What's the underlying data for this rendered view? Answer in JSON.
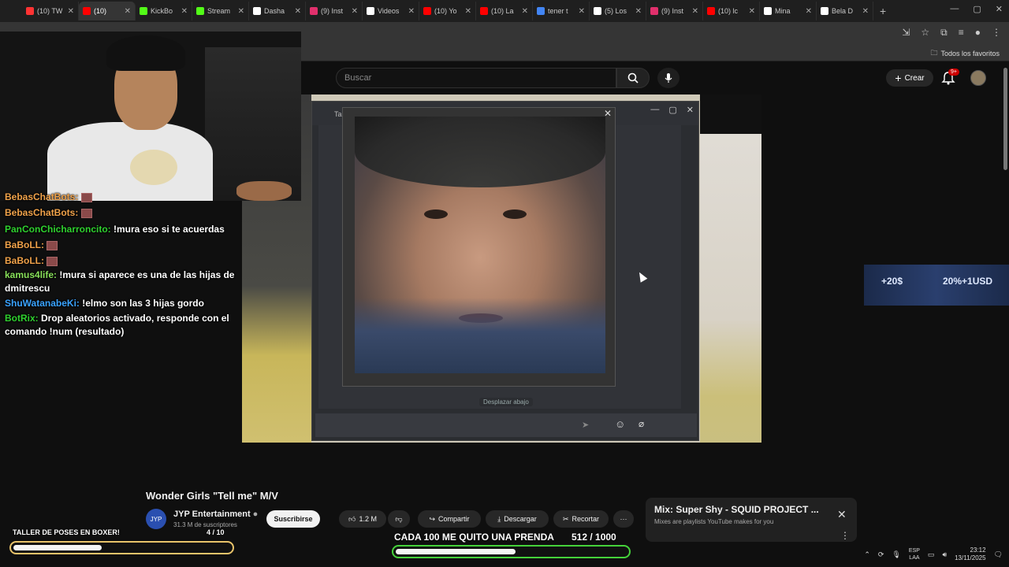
{
  "browser": {
    "tabs": [
      {
        "label": "(10) TW",
        "color": "#ff3333"
      },
      {
        "label": "(10)",
        "color": "#ff0000",
        "active": true
      },
      {
        "label": "KickBo",
        "color": "#53fc18"
      },
      {
        "label": "Stream",
        "color": "#53fc18"
      },
      {
        "label": "Dasha",
        "color": "#ffffff"
      },
      {
        "label": "(9) Inst",
        "color": "#e1306c"
      },
      {
        "label": "Videos",
        "color": "#ffffff"
      },
      {
        "label": "(10) Yo",
        "color": "#ff0000"
      },
      {
        "label": "(10) La",
        "color": "#ff0000"
      },
      {
        "label": "tener t",
        "color": "#4285f4"
      },
      {
        "label": "(5) Los",
        "color": "#ffffff"
      },
      {
        "label": "(9) Inst",
        "color": "#e1306c"
      },
      {
        "label": "(10) lc",
        "color": "#ff0000"
      },
      {
        "label": "Mina",
        "color": "#ffffff"
      },
      {
        "label": "Bela D",
        "color": "#ffffff"
      }
    ],
    "new_tab": "+",
    "all_bookmarks": "Todos los favoritos"
  },
  "youtube": {
    "search_placeholder": "Buscar",
    "create_label": "Crear",
    "notif_badge": "9+",
    "video_title": "Wonder Girls \"Tell me\" M/V",
    "channel_name": "JYP Entertainment",
    "channel_avatar_text": "JYP",
    "subscribers": "31.3 M de suscriptores",
    "subscribe_label": "Suscribirse",
    "likes": "1.2 M",
    "share_label": "Compartir",
    "download_label": "Descargar",
    "clip_label": "Recortar",
    "more_label": "···",
    "mix_title": "Mix: Super Shy - SQUID PROJECT ...",
    "mix_subtitle": "Mixes are playlists YouTube makes for you"
  },
  "chatwindow": {
    "title": "Ta",
    "scroll_hint": "Desplazar abajo"
  },
  "chat": [
    {
      "user": "BebasChatBots:",
      "cls": "u1",
      "text": ""
    },
    {
      "user": "BebasChatBots:",
      "cls": "u1",
      "text": ""
    },
    {
      "user": "PanConChicharroncito:",
      "cls": "u2",
      "text": "!mura eso si te acuerdas"
    },
    {
      "user": "BaBoLL:",
      "cls": "u3",
      "text": ""
    },
    {
      "user": "BaBoLL:",
      "cls": "u3",
      "text": ""
    },
    {
      "user": "kamus4life:",
      "cls": "u5",
      "text": "!mura si aparece es una de las hijas de dmitrescu"
    },
    {
      "user": "ShuWatanabeKi:",
      "cls": "u4",
      "text": "!elmo son las 3 hijas gordo"
    },
    {
      "user": "BotRix:",
      "cls": "u2",
      "text": "Drop aleatorios activado, responde con el comando !num (resultado)"
    }
  ],
  "ad": {
    "left": "+20$",
    "right": "20%+1USD"
  },
  "goals": {
    "left_label": "TALLER DE POSES EN BOXER!",
    "left_count": "4   / 10",
    "left_progress": 0.4,
    "right_label": "CADA 100 ME QUITO UNA PRENDA",
    "right_count": "512   / 1000",
    "right_progress": 0.512
  },
  "taskbar": {
    "lang_top": "ESP",
    "lang_bottom": "LAA",
    "time": "23:12",
    "date": "13/11/2025"
  }
}
